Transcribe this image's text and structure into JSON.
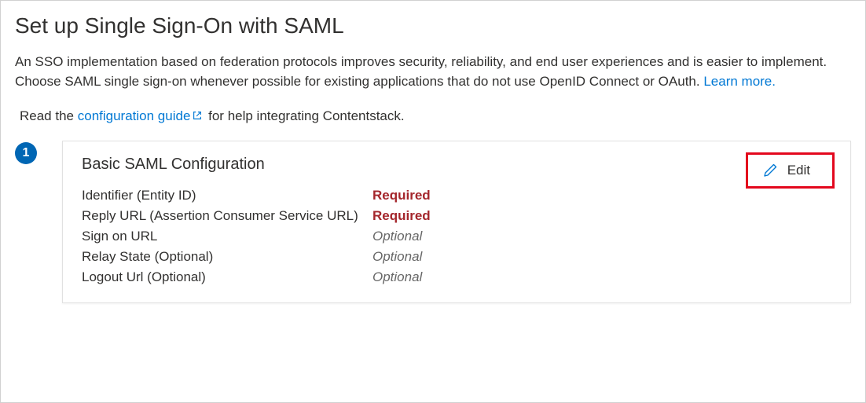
{
  "page": {
    "title": "Set up Single Sign-On with SAML",
    "description_part1": "An SSO implementation based on federation protocols improves security, reliability, and end user experiences and is easier to implement. Choose SAML single sign-on whenever possible for existing applications that do not use OpenID Connect or OAuth. ",
    "learn_more": "Learn more.",
    "guide_prefix": "Read the ",
    "guide_link": "configuration guide",
    "guide_suffix": " for help integrating Contentstack."
  },
  "step": {
    "number": "1",
    "card_title": "Basic SAML Configuration",
    "edit_label": "Edit",
    "rows": [
      {
        "label": "Identifier (Entity ID)",
        "value": "Required",
        "kind": "required"
      },
      {
        "label": "Reply URL (Assertion Consumer Service URL)",
        "value": "Required",
        "kind": "required"
      },
      {
        "label": "Sign on URL",
        "value": "Optional",
        "kind": "optional"
      },
      {
        "label": "Relay State (Optional)",
        "value": "Optional",
        "kind": "optional"
      },
      {
        "label": "Logout Url (Optional)",
        "value": "Optional",
        "kind": "optional"
      }
    ]
  }
}
